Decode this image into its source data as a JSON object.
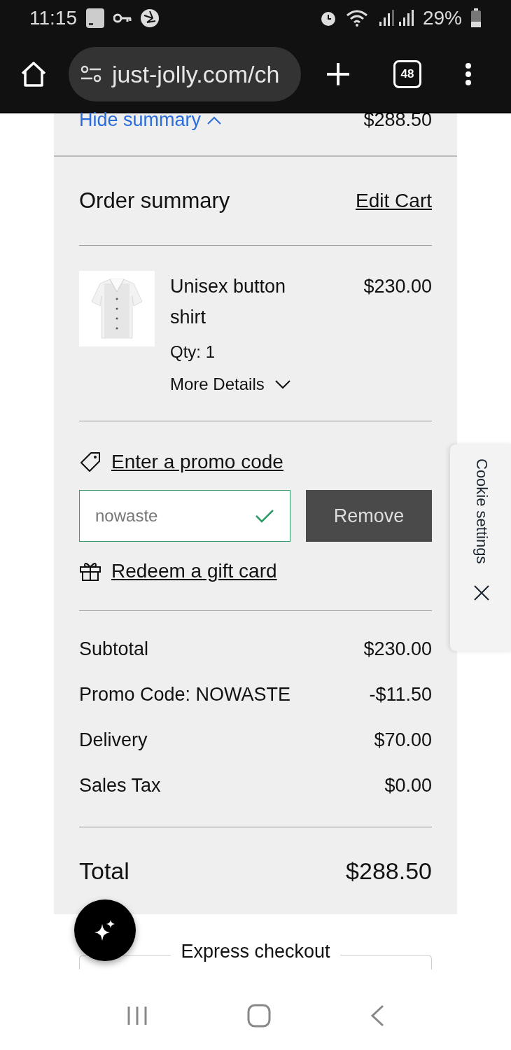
{
  "status_bar": {
    "time": "11:15",
    "battery": "29%"
  },
  "browser": {
    "url": "just-jolly.com/ch",
    "tab_count": "48"
  },
  "summary_toggle": {
    "label": "Hide summary",
    "expanded": true,
    "total": "$288.50"
  },
  "order_summary": {
    "title": "Order summary",
    "edit_link": "Edit Cart"
  },
  "items": [
    {
      "name": "Unisex button shirt",
      "price": "$230.00",
      "qty": "Qty: 1",
      "details_link": "More Details"
    }
  ],
  "promo": {
    "link": "Enter a promo code",
    "value": "nowaste",
    "valid": true,
    "button": "Remove"
  },
  "gift_card": {
    "link": "Redeem a gift card"
  },
  "totals": [
    {
      "label": "Subtotal",
      "value": "$230.00"
    },
    {
      "label": "Promo Code: NOWASTE",
      "value": "-$11.50"
    },
    {
      "label": "Delivery",
      "value": "$70.00"
    },
    {
      "label": "Sales Tax",
      "value": "$0.00"
    }
  ],
  "total": {
    "label": "Total",
    "value": "$288.50"
  },
  "express_checkout": {
    "label": "Express checkout"
  },
  "cookie_tab": {
    "label": "Cookie settings"
  }
}
